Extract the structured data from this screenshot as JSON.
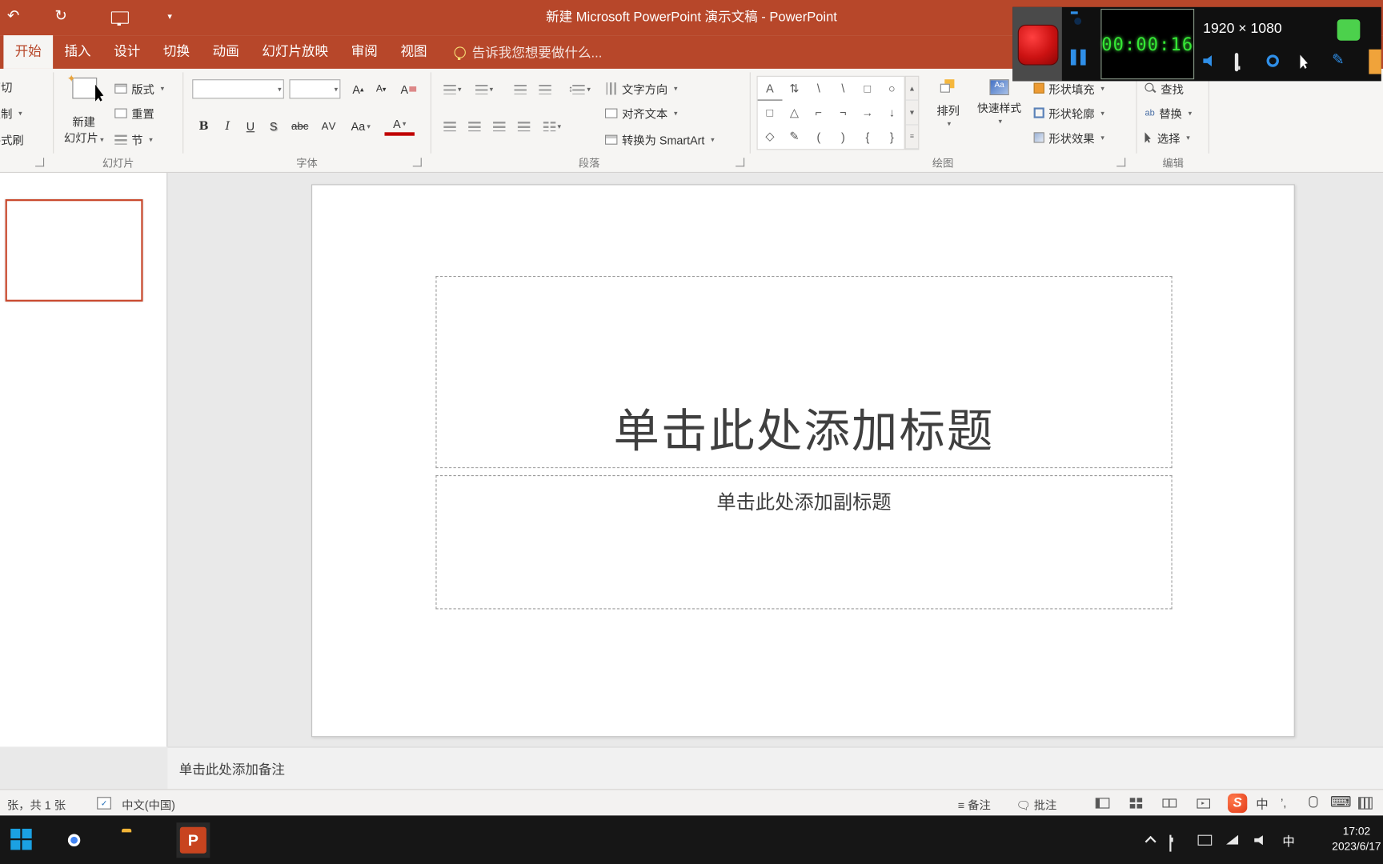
{
  "colors": {
    "accent": "#B7472A",
    "record_red": "#CC1212",
    "timer_green": "#35E835",
    "recorder_green_square": "#4CD14C",
    "recorder_orange": "#F0A33A",
    "selected_thumb_border": "#C9472B",
    "taskbar_bg": "#161616"
  },
  "title_bar": {
    "title": "新建 Microsoft PowerPoint 演示文稿 - PowerPoint"
  },
  "ribbon": {
    "tabs": [
      "开始",
      "插入",
      "设计",
      "切换",
      "动画",
      "幻灯片放映",
      "审阅",
      "视图"
    ],
    "active_tab": "开始",
    "tell_me": "告诉我您想要做什么...",
    "groups": {
      "clipboard": {
        "cut": "剪切",
        "copy": "复制",
        "format_painter": "格式刷"
      },
      "slides": {
        "label": "幻灯片",
        "new_slide": [
          "新建",
          "幻灯片"
        ],
        "layout": "版式",
        "reset": "重置",
        "section": "节"
      },
      "font": {
        "label": "字体",
        "bold": "B",
        "italic": "I",
        "underline": "U",
        "shadow": "S",
        "strike": "abc",
        "spacing": "AV",
        "case": "Aa",
        "color": "A",
        "grow": "A",
        "shrink": "A",
        "clear": "A"
      },
      "paragraph": {
        "label": "段落",
        "text_direction": "文字方向",
        "align_text": "对齐文本",
        "smartart": "转换为 SmartArt"
      },
      "drawing": {
        "label": "绘图",
        "arrange": "排列",
        "quick_styles": "快速样式",
        "shape_fill": "形状填充",
        "shape_outline": "形状轮廓",
        "shape_effects": "形状效果",
        "shapes": [
          [
            "A",
            "⇅",
            "\\",
            "\\",
            "□",
            "○"
          ],
          [
            "□",
            "△",
            "⌐",
            "¬",
            "→",
            "↓"
          ],
          [
            "◇",
            "✎",
            "(",
            ")",
            "{",
            "}"
          ]
        ]
      },
      "editing": {
        "label": "编辑",
        "find": "查找",
        "replace": "替换",
        "select": "选择"
      }
    }
  },
  "recorder": {
    "time": "00:00:16",
    "resolution": "1920 × 1080"
  },
  "slide": {
    "title_placeholder": "单击此处添加标题",
    "subtitle_placeholder": "单击此处添加副标题"
  },
  "notes": {
    "placeholder": "单击此处添加备注"
  },
  "status_bar": {
    "slide_info": "张，共 1 张",
    "language": "中文(中国)",
    "notes_btn": "备注",
    "comments_btn": "批注",
    "sogou_badge": "S",
    "ime_badge": "中",
    "punct_badge": "’,"
  },
  "taskbar": {
    "clock_time": "17:02",
    "clock_date": "2023/6/17",
    "ime_indicator": "中"
  }
}
